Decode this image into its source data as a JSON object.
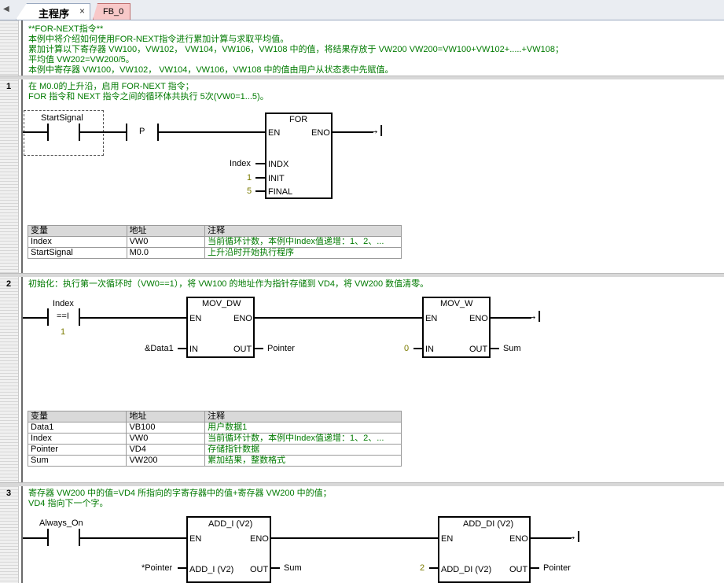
{
  "tabs": [
    {
      "label": "主程序",
      "close": "×"
    },
    {
      "label": "FB_0"
    }
  ],
  "header_comment": [
    "**FOR-NEXT指令**",
    "本例中将介绍如何使用FOR-NEXT指令进行累加计算与求取平均值。",
    "累加计算以下寄存器 VW100，VW102，  VW104，VW106，VW108 中的值，将结果存放于 VW200 VW200=VW100+VW102+.....+VW108；",
    "平均值 VW202=VW200/5。",
    "本例中寄存器 VW100，VW102，  VW104，VW106，VW108 中的值由用户从状态表中先赋值。"
  ],
  "net1": {
    "number": "1",
    "comment": [
      "在 M0.0的上升沿，启用 FOR-NEXT 指令；",
      "FOR 指令和 NEXT 指令之间的循环体共执行 5次(VW0=1...5)。"
    ],
    "contact": "StartSignal",
    "p_label": "P",
    "block": {
      "title": "FOR",
      "en": "EN",
      "eno": "ENO",
      "indx": "INDX",
      "init": "INIT",
      "final": "FINAL"
    },
    "inputs": {
      "indx": "Index",
      "init": "1",
      "final": "5"
    },
    "table": {
      "headers": [
        "变量",
        "地址",
        "注释"
      ],
      "rows": [
        [
          "Index",
          "VW0",
          "当前循环计数，本例中Index值递增：1、2、..."
        ],
        [
          "StartSignal",
          "M0.0",
          "上升沿时开始执行程序"
        ]
      ]
    }
  },
  "net2": {
    "number": "2",
    "comment": "初始化：执行第一次循环时（VW0==1），将 VW100 的地址作为指针存储到 VD4，将 VW200 数值清零。",
    "compare": {
      "var": "Index",
      "op": "==I",
      "value": "1"
    },
    "block1": {
      "title": "MOV_DW",
      "en": "EN",
      "eno": "ENO",
      "in": "IN",
      "out": "OUT",
      "in_val": "&Data1",
      "out_val": "Pointer"
    },
    "block2": {
      "title": "MOV_W",
      "en": "EN",
      "eno": "ENO",
      "in": "IN",
      "out": "OUT",
      "in_val": "0",
      "out_val": "Sum"
    },
    "table": {
      "headers": [
        "变量",
        "地址",
        "注释"
      ],
      "rows": [
        [
          "Data1",
          "VB100",
          "用户数据1"
        ],
        [
          "Index",
          "VW0",
          "当前循环计数，本例中Index值递增：1、2、..."
        ],
        [
          "Pointer",
          "VD4",
          "存储指针数据"
        ],
        [
          "Sum",
          "VW200",
          "累加结果，整数格式"
        ]
      ]
    }
  },
  "net3": {
    "number": "3",
    "comment": [
      "寄存器 VW200 中的值=VD4 所指向的字寄存器中的值+寄存器 VW200 中的值；",
      "VD4 指向下一个字。"
    ],
    "contact": "Always_On",
    "block1": {
      "title": "ADD_I (V2)",
      "en": "EN",
      "eno": "ENO",
      "in": "ADD_I (V2)",
      "out": "OUT",
      "in_val": "*Pointer",
      "out_val": "Sum"
    },
    "block2": {
      "title": "ADD_DI (V2)",
      "en": "EN",
      "eno": "ENO",
      "in": "ADD_DI (V2)",
      "out": "OUT",
      "in_val": "2",
      "out_val": "Pointer"
    }
  }
}
